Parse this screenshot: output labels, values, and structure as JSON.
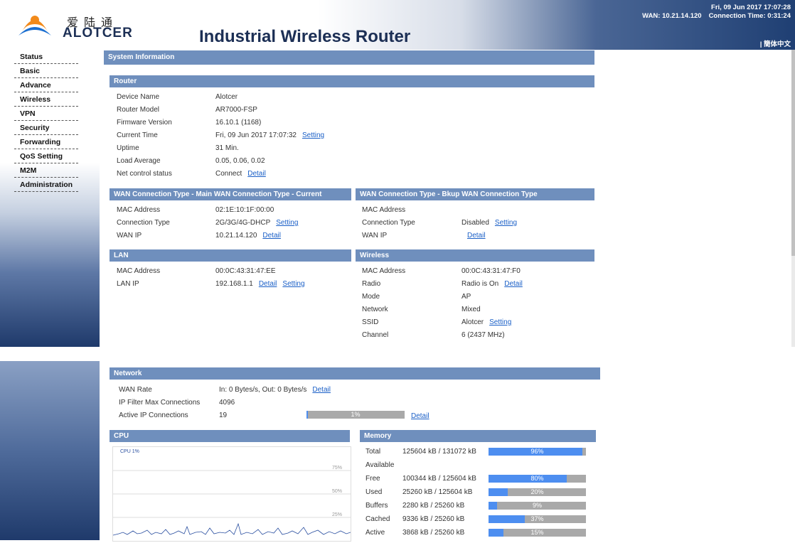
{
  "header": {
    "logo_cn": "爱陆通",
    "logo_en": "ALOTCER",
    "title": "Industrial Wireless Router",
    "datetime": "Fri, 09 Jun 2017 17:07:28",
    "wan": "WAN: 10.21.14.120",
    "connection_time": "Connection Time: 0:31:24",
    "language": "| 簡体中文"
  },
  "nav": [
    "Status",
    "Basic",
    "Advance",
    "Wireless",
    "VPN",
    "Security",
    "Forwarding",
    "QoS Setting",
    "M2M",
    "Administration"
  ],
  "system_info": {
    "title": "System Information"
  },
  "router": {
    "title": "Router",
    "rows": [
      {
        "label": "Device Name",
        "value": "Alotcer"
      },
      {
        "label": "Router Model",
        "value": "AR7000-FSP"
      },
      {
        "label": "Firmware Version",
        "value": "16.10.1 (1168)"
      },
      {
        "label": "Current Time",
        "value": "Fri, 09 Jun 2017 17:07:32",
        "link": "Setting"
      },
      {
        "label": "Uptime",
        "value": "31 Min."
      },
      {
        "label": "Load Average",
        "value": "0.05, 0.06, 0.02"
      },
      {
        "label": "Net control status",
        "value": "Connect",
        "link": "Detail"
      }
    ]
  },
  "wan_main": {
    "title": "WAN Connection Type - Main WAN Connection Type - Current",
    "rows": [
      {
        "label": "MAC Address",
        "value": "02:1E:10:1F:00:00"
      },
      {
        "label": "Connection Type",
        "value": "2G/3G/4G-DHCP",
        "link": "Setting"
      },
      {
        "label": "WAN IP",
        "value": "10.21.14.120",
        "link": "Detail"
      }
    ]
  },
  "wan_backup": {
    "title": "WAN Connection Type - Bkup WAN Connection Type",
    "rows": [
      {
        "label": "MAC Address",
        "value": ""
      },
      {
        "label": "Connection Type",
        "value": "Disabled",
        "link": "Setting"
      },
      {
        "label": "WAN IP",
        "value": "",
        "link": "Detail"
      }
    ]
  },
  "lan": {
    "title": "LAN",
    "rows": [
      {
        "label": "MAC Address",
        "value": "00:0C:43:31:47:EE"
      },
      {
        "label": "LAN IP",
        "value": "192.168.1.1",
        "link": "Detail",
        "link2": "Setting"
      }
    ]
  },
  "wireless": {
    "title": "Wireless",
    "rows": [
      {
        "label": "MAC Address",
        "value": "00:0C:43:31:47:F0"
      },
      {
        "label": "Radio",
        "value": "Radio is On",
        "link": "Detail"
      },
      {
        "label": "Mode",
        "value": "AP"
      },
      {
        "label": "Network",
        "value": "Mixed"
      },
      {
        "label": "SSID",
        "value": "Alotcer",
        "link": "Setting"
      },
      {
        "label": "Channel",
        "value": "6 (2437 MHz)"
      }
    ]
  },
  "network": {
    "title": "Network",
    "wan_rate_label": "WAN Rate",
    "wan_rate_value": "In: 0 Bytes/s, Out: 0 Bytes/s",
    "wan_rate_link": "Detail",
    "ipf_label": "IP Filter Max Connections",
    "ipf_value": "4096",
    "active_label": "Active IP Connections",
    "active_value": "19",
    "active_pct_text": "1%",
    "active_pct": 0.01,
    "active_link": "Detail"
  },
  "cpu": {
    "title": "CPU",
    "legend": "CPU 1%",
    "ticks": [
      "75%",
      "50%",
      "25%"
    ]
  },
  "memory": {
    "title": "Memory",
    "rows": [
      {
        "label": "Total",
        "value": "125604 kB / 131072 kB",
        "pct_text": "96%",
        "pct": 0.96
      },
      {
        "label": "Available",
        "value": ""
      },
      {
        "label": "Free",
        "value": "100344 kB / 125604 kB",
        "pct_text": "80%",
        "pct": 0.8
      },
      {
        "label": "Used",
        "value": "25260 kB / 125604 kB",
        "pct_text": "20%",
        "pct": 0.2
      },
      {
        "label": "Buffers",
        "value": "2280 kB / 25260 kB",
        "pct_text": "9%",
        "pct": 0.09
      },
      {
        "label": "Cached",
        "value": "9336 kB / 25260 kB",
        "pct_text": "37%",
        "pct": 0.37
      },
      {
        "label": "Active",
        "value": "3868 kB / 25260 kB",
        "pct_text": "15%",
        "pct": 0.15
      }
    ]
  },
  "colors": {
    "section_bar": "#6f8fbd",
    "link": "#1a5fc7",
    "bar_fill": "#4d8ef0",
    "bar_bg": "#a9a9a9",
    "header_dark": "#1f3f73"
  }
}
